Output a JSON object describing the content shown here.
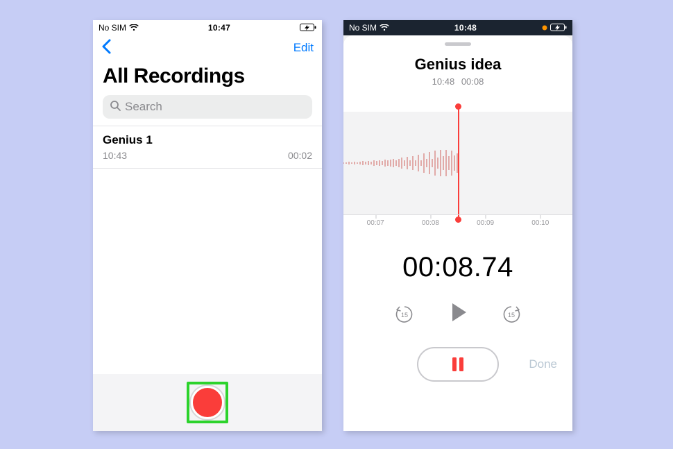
{
  "left": {
    "status": {
      "carrier": "No SIM",
      "time": "10:47"
    },
    "nav": {
      "edit_label": "Edit"
    },
    "title": "All Recordings",
    "search": {
      "placeholder": "Search"
    },
    "items": [
      {
        "name": "Genius 1",
        "time": "10:43",
        "duration": "00:02"
      }
    ]
  },
  "right": {
    "status": {
      "carrier": "No SIM",
      "time": "10:48"
    },
    "recording": {
      "title": "Genius idea",
      "sub_time": "10:48",
      "sub_duration": "00:08"
    },
    "ruler": [
      "00:07",
      "00:08",
      "00:09",
      "00:10"
    ],
    "timer": "00:08.74",
    "skip_amount": "15",
    "done_label": "Done"
  },
  "colors": {
    "accent_blue": "#007aff",
    "accent_red": "#fa3d3a"
  }
}
